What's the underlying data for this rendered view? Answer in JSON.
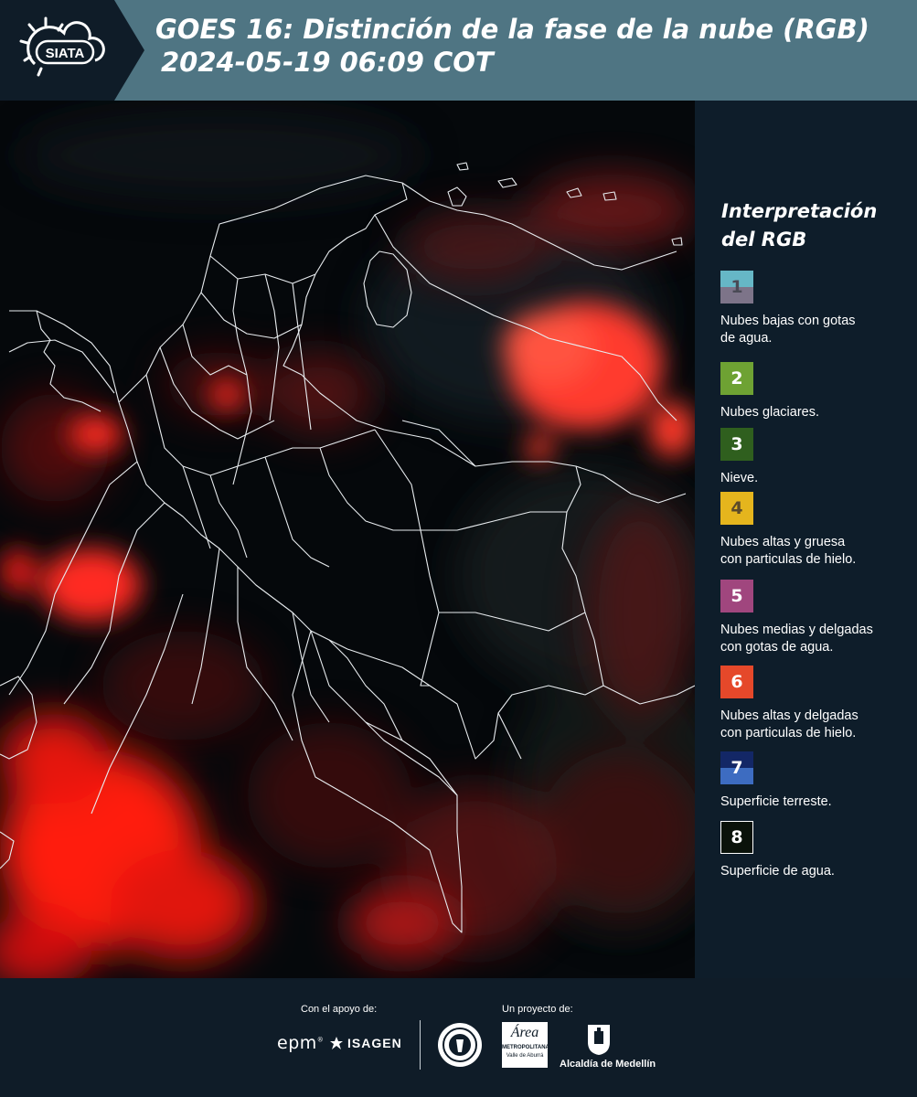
{
  "header": {
    "logo_text": "SIATA",
    "title_line1": "GOES 16: Distinción de la fase de la nube (RGB)",
    "title_line2": "2024-05-19 06:09 COT"
  },
  "legend": {
    "title_line1": "Interpretación",
    "title_line2": "del RGB",
    "items": [
      {
        "number": "1",
        "label_line1": "Nubes bajas con gotas",
        "label_line2": "de agua.",
        "color_top": "#66b7c6",
        "color_bottom": "#7d7489",
        "text_color": "#4a4a55"
      },
      {
        "number": "2",
        "label_line1": "Nubes glaciares.",
        "label_line2": "",
        "color_top": "#6ea233",
        "color_bottom": "#6ea233",
        "text_color": "#ffffff"
      },
      {
        "number": "3",
        "label_line1": "Nieve.",
        "label_line2": "",
        "color_top": "#2f5f1e",
        "color_bottom": "#2f5f1e",
        "text_color": "#ffffff"
      },
      {
        "number": "4",
        "label_line1": "Nubes altas y gruesa",
        "label_line2": "con particulas de hielo.",
        "color_top": "#e5b51d",
        "color_bottom": "#e5b51d",
        "text_color": "#5a4a2a"
      },
      {
        "number": "5",
        "label_line1": "Nubes medias y delgadas",
        "label_line2": "con gotas de agua.",
        "color_top": "#a0467e",
        "color_bottom": "#a0467e",
        "text_color": "#ffffff"
      },
      {
        "number": "6",
        "label_line1": "Nubes altas y delgadas",
        "label_line2": "con particulas de hielo.",
        "color_top": "#e5482a",
        "color_bottom": "#e5482a",
        "text_color": "#ffffff"
      },
      {
        "number": "7",
        "label_line1": "Superficie terreste.",
        "label_line2": "",
        "color_top": "#132766",
        "color_bottom": "#3d6cc1",
        "text_color": "#ffffff"
      },
      {
        "number": "8",
        "label_line1": "Superficie de agua.",
        "label_line2": "",
        "color_top": "#0a120a",
        "color_bottom": "#0a120a",
        "text_color": "#ffffff"
      }
    ]
  },
  "footer": {
    "support_label": "Con el apoyo de:",
    "project_label": "Un proyecto de:",
    "sponsor_epm": "epm",
    "sponsor_isagen": "ISAGEN",
    "sponsor_area_line1": "Área",
    "sponsor_area_line2": "METROPOLITANA",
    "sponsor_area_line3": "Valle de Aburrá",
    "sponsor_medellin": "Alcaldía de Medellín"
  }
}
